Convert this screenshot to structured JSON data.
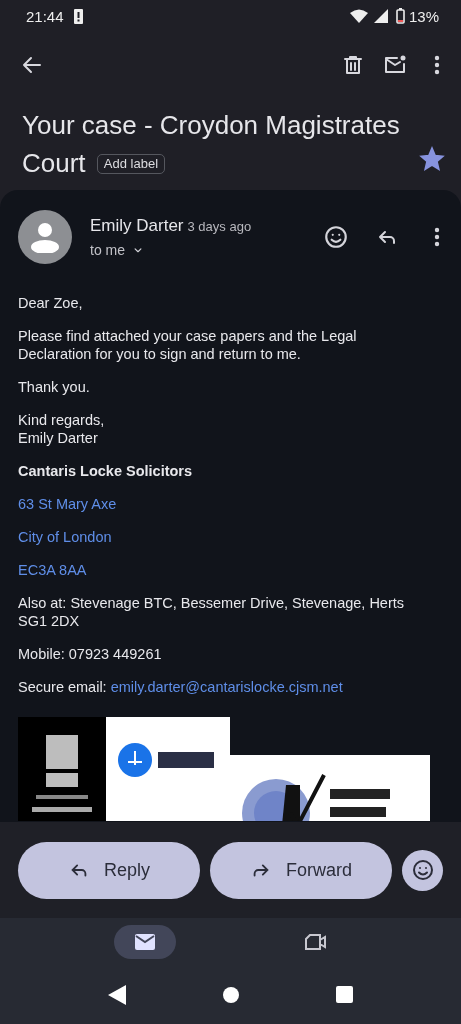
{
  "status_bar": {
    "time": "21:44",
    "battery": "13%"
  },
  "subject": {
    "title_lines": [
      "Your case - Croydon Magistrates",
      "Court"
    ],
    "label_button": "Add label",
    "starred": true
  },
  "message": {
    "sender": "Emily Darter",
    "time": "3 days ago",
    "recipient": "to me",
    "body": [
      {
        "kind": "text",
        "lines": [
          "Dear Zoe,"
        ]
      },
      {
        "kind": "text",
        "lines": [
          "Please find attached your case papers and the Legal Declaration for you to sign and return to me."
        ]
      },
      {
        "kind": "text",
        "lines": [
          "Thank you."
        ]
      },
      {
        "kind": "text",
        "lines": [
          "Kind regards,",
          "Emily Darter"
        ]
      },
      {
        "kind": "bold",
        "lines": [
          "Cantaris Locke Solicitors"
        ]
      },
      {
        "kind": "link",
        "lines": [
          "63 St Mary Axe"
        ]
      },
      {
        "kind": "link",
        "lines": [
          "City of London"
        ]
      },
      {
        "kind": "link",
        "lines": [
          "EC3A 8AA"
        ]
      },
      {
        "kind": "text",
        "lines": [
          "Also at: Stevenage BTC, Bessemer Drive, Stevenage, Herts SG1 2DX"
        ]
      },
      {
        "kind": "text",
        "lines": [
          "Mobile: 07923 449261"
        ]
      },
      {
        "kind": "text_link",
        "text": "Secure email:",
        "link": "emily.darter@cantarislocke.cjsm.net"
      }
    ]
  },
  "actions": [
    {
      "label": "Reply",
      "kind": "reply"
    },
    {
      "label": "Forward",
      "kind": "forward"
    }
  ],
  "bottom_nav": [
    {
      "kind": "mail",
      "selected": true
    },
    {
      "kind": "video",
      "selected": false
    }
  ]
}
